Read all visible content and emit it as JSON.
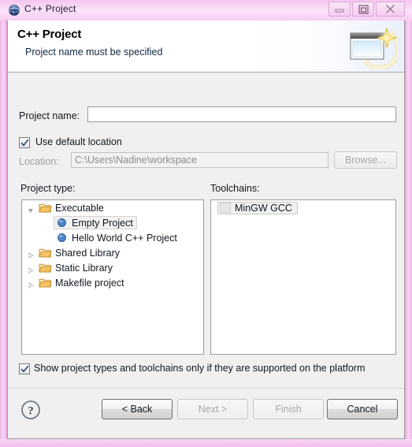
{
  "window": {
    "title": "C++ Project",
    "title_icon": "globe-icon",
    "controls": {
      "minimize": "Minimize",
      "restore": "Restore",
      "close": "Close"
    },
    "frame_color": "#f6c9f1"
  },
  "header": {
    "title": "C++ Project",
    "subtitle": "Project name must be specified",
    "icon": "new-project-wizard-icon"
  },
  "form": {
    "project_name_label": "Project name:",
    "project_name_value": "",
    "project_name_placeholder": "",
    "use_default_location_label": "Use default location",
    "use_default_location_checked": true,
    "location_label": "Location:",
    "location_value": "C:\\Users\\Nadine\\workspace",
    "location_enabled": false,
    "browse_label": "Browse...",
    "browse_enabled": false
  },
  "project_type": {
    "label": "Project type:",
    "items": [
      {
        "label": "Executable",
        "icon": "folder-icon",
        "indent": 0,
        "expanded": true,
        "selected": false
      },
      {
        "label": "Empty Project",
        "icon": "bullet-icon",
        "indent": 1,
        "expanded": false,
        "selected": true
      },
      {
        "label": "Hello World C++ Project",
        "icon": "bullet-icon",
        "indent": 1,
        "expanded": false,
        "selected": false
      },
      {
        "label": "Shared Library",
        "icon": "folder-icon",
        "indent": 0,
        "expanded": false,
        "selected": false
      },
      {
        "label": "Static Library",
        "icon": "folder-icon",
        "indent": 0,
        "expanded": false,
        "selected": false
      },
      {
        "label": "Makefile project",
        "icon": "folder-icon",
        "indent": 0,
        "expanded": false,
        "selected": false
      }
    ]
  },
  "toolchains": {
    "label": "Toolchains:",
    "items": [
      {
        "label": "MinGW GCC",
        "icon": "toolchain-icon",
        "selected": true
      }
    ]
  },
  "options": {
    "show_supported_label": "Show project types and toolchains only if they are supported on the platform",
    "show_supported_checked": true
  },
  "footer": {
    "help_icon": "help-question-icon",
    "buttons": [
      {
        "name": "back",
        "label": "< Back",
        "enabled": true
      },
      {
        "name": "next",
        "label": "Next >",
        "enabled": false
      },
      {
        "name": "finish",
        "label": "Finish",
        "enabled": false
      },
      {
        "name": "cancel",
        "label": "Cancel",
        "enabled": true
      }
    ]
  },
  "colors": {
    "accent_pink": "#f6c9f1",
    "dialog_bg": "#f0f0f0",
    "selection_bg": "#f1f1f1",
    "folder_icon": "#e8a33d",
    "bullet_icon": "#4a7fc1"
  }
}
